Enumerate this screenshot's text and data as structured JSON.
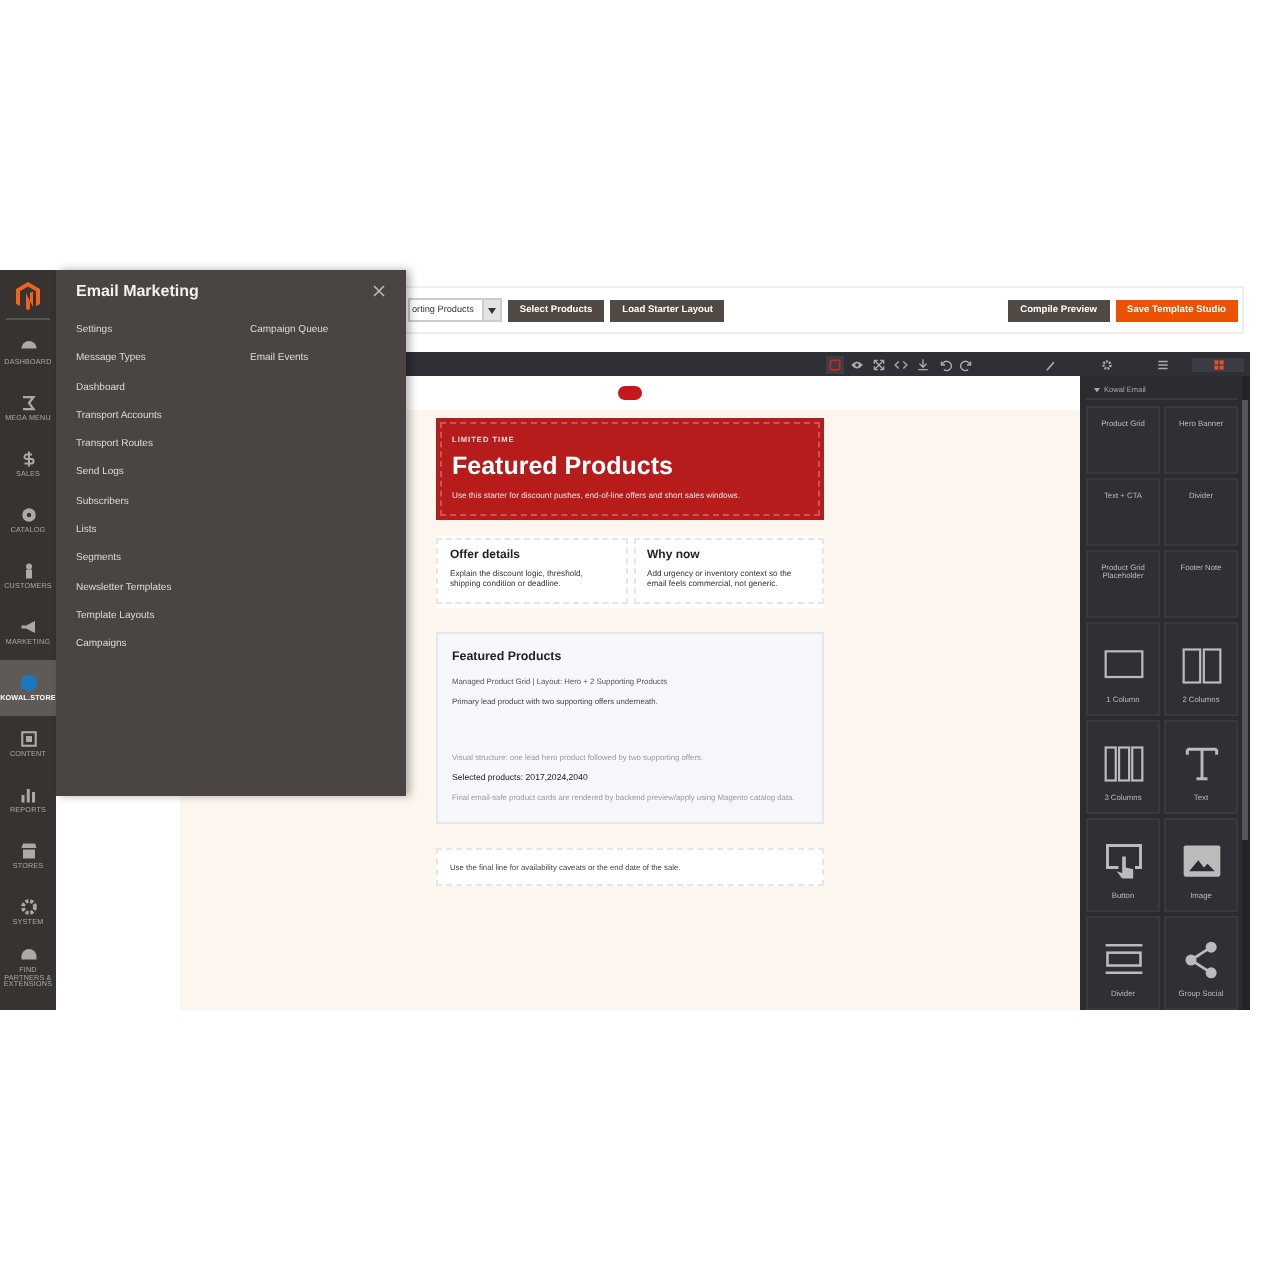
{
  "sidebar": {
    "items": [
      {
        "label": "DASHBOARD",
        "selected": false
      },
      {
        "label": "MEGA MENU",
        "selected": false
      },
      {
        "label": "SALES",
        "selected": false
      },
      {
        "label": "CATALOG",
        "selected": false
      },
      {
        "label": "CUSTOMERS",
        "selected": false
      },
      {
        "label": "MARKETING",
        "selected": false
      },
      {
        "label": "KOWAL.STORE",
        "selected": true
      },
      {
        "label": "CONTENT",
        "selected": false
      },
      {
        "label": "REPORTS",
        "selected": false
      },
      {
        "label": "STORES",
        "selected": false
      },
      {
        "label": "SYSTEM",
        "selected": false
      },
      {
        "label": "FIND PARTNERS & EXTENSIONS",
        "selected": false
      }
    ]
  },
  "flyout": {
    "title": "Email Marketing",
    "column_1": [
      "Settings",
      "Message Types",
      "Dashboard",
      "Transport Accounts",
      "Transport Routes",
      "Send Logs",
      "Subscribers",
      "Lists",
      "Segments",
      "Newsletter Templates",
      "Template Layouts",
      "Campaigns"
    ],
    "column_2": [
      "Campaign Queue",
      "Email Events"
    ]
  },
  "toolbar": {
    "product_select": {
      "value": "orting Products"
    },
    "buttons": [
      {
        "label": "Select Products",
        "kind": "secondary"
      },
      {
        "label": "Load Starter Layout",
        "kind": "secondary"
      },
      {
        "label": "Compile Preview",
        "kind": "secondary"
      },
      {
        "label": "Save Template Studio",
        "kind": "primary"
      }
    ]
  },
  "editor": {
    "tools": [
      {
        "selected": true
      },
      {
        "selected": false
      },
      {
        "selected": false
      },
      {
        "selected": false
      },
      {
        "selected": false
      },
      {
        "selected": false
      },
      {
        "selected": false
      }
    ],
    "panels": [
      {
        "selected": false
      },
      {
        "selected": false
      },
      {
        "selected": false
      },
      {
        "selected": true
      }
    ]
  },
  "email": {
    "hero": {
      "eyebrow": "LIMITED TIME",
      "title": "Featured Products",
      "text": "Use this starter for discount pushes, end-of-line offers and short sales windows."
    },
    "columns": [
      {
        "title": "Offer details",
        "text": "Explain the discount logic, threshold, shipping condition or deadline."
      },
      {
        "title": "Why now",
        "text": "Add urgency or inventory context so the email feels commercial, not generic."
      }
    ],
    "product_block": {
      "title": "Featured Products",
      "lines": [
        {
          "kind": "meta",
          "text": "Managed Product Grid | Layout: Hero + 2 Supporting Products"
        },
        {
          "kind": "body",
          "text": "Primary lead product with two supporting offers underneath."
        },
        {
          "kind": "muted",
          "text": "Visual structure: one lead hero product followed by two supporting offers."
        },
        {
          "kind": "strong",
          "text": "Selected products: 2017,2024,2040"
        },
        {
          "kind": "muted",
          "text": "Final email-safe product cards are rendered by backend preview/apply using Magento catalog data."
        }
      ]
    },
    "footer_note": "Use the final line for availability caveats or the end date of the sale."
  },
  "blocks": {
    "category": "Kowal Email",
    "items": [
      {
        "label": "Product Grid",
        "kind": "text"
      },
      {
        "label": "Hero Banner",
        "kind": "text"
      },
      {
        "label": "Text + CTA",
        "kind": "text"
      },
      {
        "label": "Divider",
        "kind": "text"
      },
      {
        "label": "Product Grid Placeholder",
        "kind": "text"
      },
      {
        "label": "Footer Note",
        "kind": "text"
      },
      {
        "label": "1 Column",
        "kind": "one-column"
      },
      {
        "label": "2 Columns",
        "kind": "two-columns"
      },
      {
        "label": "3 Columns",
        "kind": "three-columns"
      },
      {
        "label": "Text",
        "kind": "text-tool"
      },
      {
        "label": "Button",
        "kind": "button"
      },
      {
        "label": "Image",
        "kind": "image"
      },
      {
        "label": "Divider",
        "kind": "divider"
      },
      {
        "label": "Group Social",
        "kind": "share"
      }
    ]
  }
}
